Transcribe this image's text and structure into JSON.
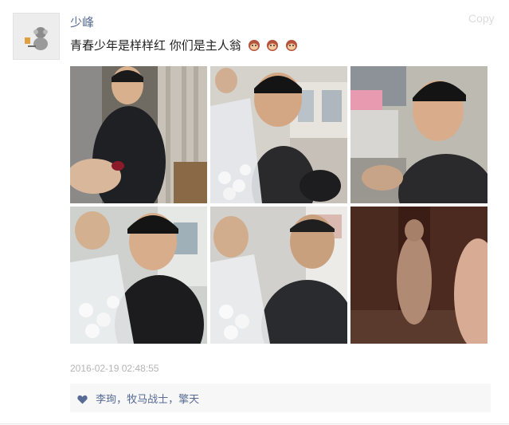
{
  "post": {
    "username": "少峰",
    "copy_label": "Copy",
    "text": "青春少年是样样红 你们是主人翁",
    "emoji_icon": "monkey-face-emoji",
    "timestamp": "2016-02-19 02:48:55"
  },
  "photos": [
    {
      "label": "photo-1"
    },
    {
      "label": "photo-2"
    },
    {
      "label": "photo-3"
    },
    {
      "label": "photo-4"
    },
    {
      "label": "photo-5"
    },
    {
      "label": "photo-6"
    }
  ],
  "likes": {
    "icon": "heart-icon",
    "names": "李珣，牧马战士，擎天"
  },
  "colors": {
    "name_blue": "#576b95",
    "timestamp_gray": "#b5b5b5",
    "likes_bg": "#f7f7f7"
  }
}
